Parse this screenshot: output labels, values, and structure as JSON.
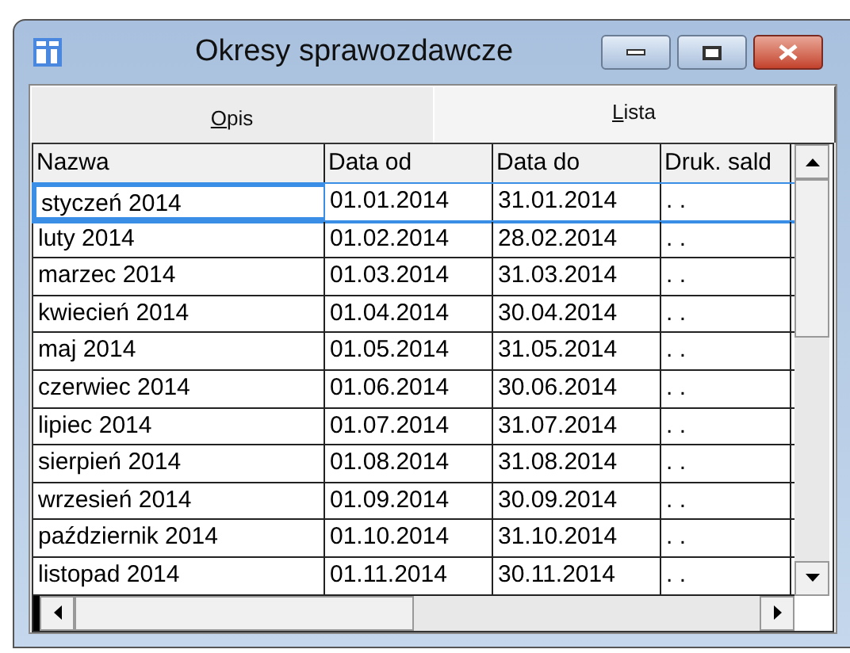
{
  "window": {
    "title": "Okresy sprawozdawcze"
  },
  "tabs": [
    {
      "label": "Opis",
      "selected": false
    },
    {
      "label": "Lista",
      "selected": true
    }
  ],
  "table": {
    "columns": [
      "Nazwa",
      "Data od",
      "Data do",
      "Druk. sald"
    ],
    "rows": [
      {
        "cells": [
          "styczeń 2014",
          "01.01.2014",
          "31.01.2014",
          ". ."
        ],
        "selected": true
      },
      {
        "cells": [
          "luty 2014",
          "01.02.2014",
          "28.02.2014",
          ". ."
        ],
        "selected": false
      },
      {
        "cells": [
          "marzec 2014",
          "01.03.2014",
          "31.03.2014",
          ". ."
        ],
        "selected": false
      },
      {
        "cells": [
          "kwiecień 2014",
          "01.04.2014",
          "30.04.2014",
          ". ."
        ],
        "selected": false
      },
      {
        "cells": [
          "maj 2014",
          "01.05.2014",
          "31.05.2014",
          ". ."
        ],
        "selected": false
      },
      {
        "cells": [
          "czerwiec 2014",
          "01.06.2014",
          "30.06.2014",
          ". ."
        ],
        "selected": false
      },
      {
        "cells": [
          "lipiec 2014",
          "01.07.2014",
          "31.07.2014",
          ". ."
        ],
        "selected": false
      },
      {
        "cells": [
          "sierpień 2014",
          "01.08.2014",
          "31.08.2014",
          ". ."
        ],
        "selected": false
      },
      {
        "cells": [
          "wrzesień 2014",
          "01.09.2014",
          "30.09.2014",
          ". ."
        ],
        "selected": false
      },
      {
        "cells": [
          "październik 2014",
          "01.10.2014",
          "31.10.2014",
          ". ."
        ],
        "selected": false
      },
      {
        "cells": [
          "listopad 2014",
          "01.11.2014",
          "30.11.2014",
          ". ."
        ],
        "selected": false
      }
    ]
  }
}
